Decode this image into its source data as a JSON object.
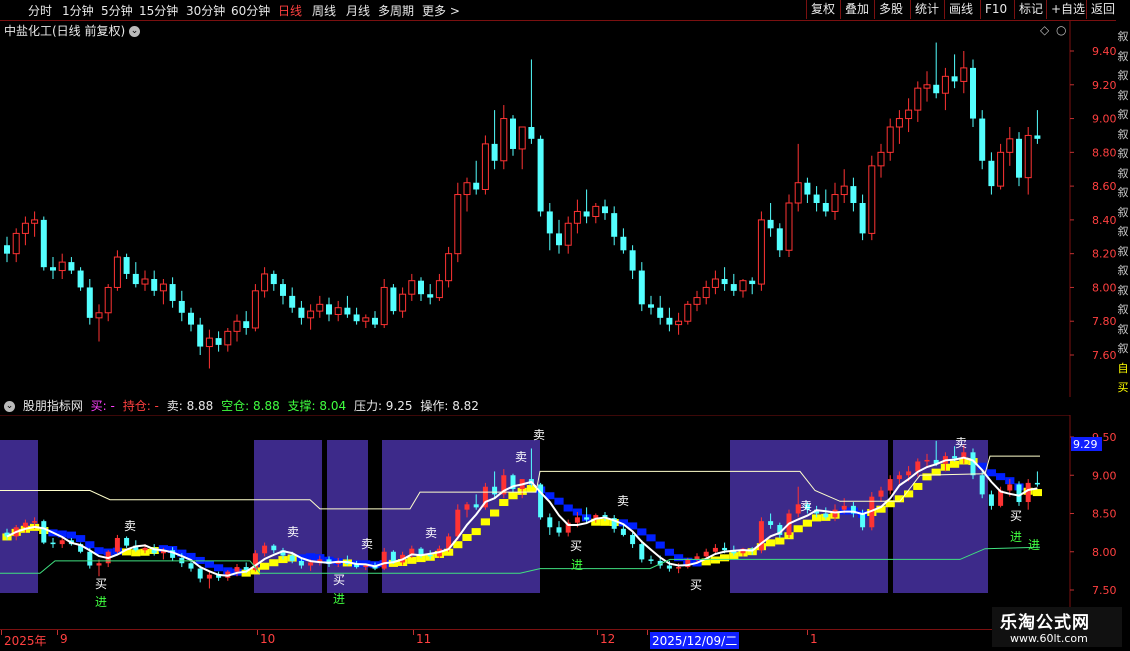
{
  "toolbar": {
    "periods": [
      "分时",
      "1分钟",
      "5分钟",
      "15分钟",
      "30分钟",
      "60分钟",
      "日线",
      "周线",
      "月线",
      "多周期",
      "更多 >"
    ],
    "active": "日线",
    "right_buttons": [
      "复权",
      "叠加",
      "多股",
      "统计",
      "画线",
      "F10",
      "标记",
      "+自选",
      "返回"
    ]
  },
  "stock": {
    "title": "中盐化工(日线 前复权)"
  },
  "main_axis": {
    "labels": [
      "9.40",
      "9.20",
      "9.00",
      "8.80",
      "8.60",
      "8.40",
      "8.20",
      "8.00",
      "7.80",
      "7.60"
    ]
  },
  "indicator": {
    "name": "股朋指标网",
    "buy": "买: -",
    "hold": "持仓: -",
    "sell": "卖: 8.88",
    "empty": "空仓: 8.88",
    "support": "支撑: 8.04",
    "pressure": "压力: 9.25",
    "operation": "操作: 8.82",
    "current_value": "9.29"
  },
  "sub_axis": {
    "labels": [
      "9.50",
      "9.00",
      "8.50",
      "8.00",
      "7.50"
    ]
  },
  "x_axis": {
    "labels": [
      "2025年",
      "9",
      "10",
      "11",
      "12",
      "2025/12/09/二",
      "1"
    ]
  },
  "right_column": {
    "chars": [
      "叙",
      "叙",
      "叙",
      "叙",
      "叙",
      "叙",
      "叙",
      "叙",
      "叙",
      "叙",
      "叙",
      "叙",
      "叙",
      "叙",
      "叙",
      "叙",
      "叙",
      "自",
      "买"
    ]
  },
  "signals": {
    "sell": "卖",
    "buy": "买",
    "enter": "进"
  },
  "watermark": {
    "name": "乐淘公式网",
    "url": "www.60lt.com"
  },
  "colors": {
    "up": "#ff3333",
    "down": "#54ffff",
    "band": "#3d2a8a",
    "yellow": "#ffff00",
    "blue": "#0020ff",
    "axis": "#7a1010"
  },
  "chart_data": {
    "type": "candlestick",
    "ylim": [
      7.5,
      9.5
    ],
    "candles": [
      [
        8.25,
        8.3,
        8.15,
        8.2
      ],
      [
        8.2,
        8.35,
        8.15,
        8.32
      ],
      [
        8.32,
        8.42,
        8.25,
        8.38
      ],
      [
        8.38,
        8.45,
        8.3,
        8.4
      ],
      [
        8.4,
        8.42,
        8.1,
        8.12
      ],
      [
        8.12,
        8.18,
        8.05,
        8.1
      ],
      [
        8.1,
        8.2,
        8.05,
        8.15
      ],
      [
        8.15,
        8.18,
        8.08,
        8.1
      ],
      [
        8.1,
        8.12,
        7.98,
        8.0
      ],
      [
        8.0,
        8.05,
        7.78,
        7.82
      ],
      [
        7.82,
        7.9,
        7.68,
        7.85
      ],
      [
        7.85,
        8.02,
        7.8,
        8.0
      ],
      [
        8.0,
        8.22,
        7.98,
        8.18
      ],
      [
        8.18,
        8.2,
        8.05,
        8.08
      ],
      [
        8.08,
        8.15,
        8.0,
        8.02
      ],
      [
        8.02,
        8.1,
        7.98,
        8.05
      ],
      [
        8.05,
        8.1,
        7.95,
        7.98
      ],
      [
        7.98,
        8.05,
        7.9,
        8.02
      ],
      [
        8.02,
        8.06,
        7.88,
        7.92
      ],
      [
        7.92,
        7.98,
        7.8,
        7.85
      ],
      [
        7.85,
        7.88,
        7.74,
        7.78
      ],
      [
        7.78,
        7.82,
        7.6,
        7.65
      ],
      [
        7.65,
        7.75,
        7.52,
        7.7
      ],
      [
        7.7,
        7.74,
        7.62,
        7.66
      ],
      [
        7.66,
        7.76,
        7.62,
        7.74
      ],
      [
        7.74,
        7.84,
        7.68,
        7.8
      ],
      [
        7.8,
        7.86,
        7.72,
        7.76
      ],
      [
        7.76,
        8.02,
        7.74,
        7.98
      ],
      [
        7.98,
        8.12,
        7.94,
        8.08
      ],
      [
        8.08,
        8.1,
        7.98,
        8.02
      ],
      [
        8.02,
        8.05,
        7.9,
        7.95
      ],
      [
        7.95,
        8.0,
        7.85,
        7.88
      ],
      [
        7.88,
        7.92,
        7.78,
        7.82
      ],
      [
        7.82,
        7.9,
        7.75,
        7.86
      ],
      [
        7.86,
        7.95,
        7.82,
        7.9
      ],
      [
        7.9,
        7.94,
        7.8,
        7.84
      ],
      [
        7.84,
        7.92,
        7.8,
        7.88
      ],
      [
        7.88,
        7.95,
        7.82,
        7.84
      ],
      [
        7.84,
        7.88,
        7.78,
        7.8
      ],
      [
        7.8,
        7.84,
        7.76,
        7.82
      ],
      [
        7.82,
        7.86,
        7.76,
        7.78
      ],
      [
        7.78,
        8.05,
        7.76,
        8.0
      ],
      [
        8.0,
        8.02,
        7.84,
        7.86
      ],
      [
        7.86,
        8.0,
        7.82,
        7.96
      ],
      [
        7.96,
        8.08,
        7.92,
        8.04
      ],
      [
        8.04,
        8.06,
        7.92,
        7.96
      ],
      [
        7.96,
        8.02,
        7.9,
        7.94
      ],
      [
        7.94,
        8.08,
        7.92,
        8.04
      ],
      [
        8.04,
        8.24,
        8.0,
        8.2
      ],
      [
        8.2,
        8.62,
        8.15,
        8.55
      ],
      [
        8.55,
        8.65,
        8.45,
        8.62
      ],
      [
        8.62,
        8.75,
        8.55,
        8.58
      ],
      [
        8.58,
        8.9,
        8.55,
        8.85
      ],
      [
        8.85,
        9.05,
        8.7,
        8.75
      ],
      [
        8.75,
        9.08,
        8.7,
        9.0
      ],
      [
        9.0,
        9.02,
        8.78,
        8.82
      ],
      [
        8.82,
        8.85,
        8.7,
        8.95
      ],
      [
        8.95,
        9.35,
        8.85,
        8.88
      ],
      [
        8.88,
        8.9,
        8.42,
        8.45
      ],
      [
        8.45,
        8.5,
        8.22,
        8.32
      ],
      [
        8.32,
        8.4,
        8.2,
        8.25
      ],
      [
        8.25,
        8.42,
        8.2,
        8.38
      ],
      [
        8.38,
        8.52,
        8.32,
        8.45
      ],
      [
        8.45,
        8.58,
        8.38,
        8.42
      ],
      [
        8.42,
        8.5,
        8.38,
        8.48
      ],
      [
        8.48,
        8.52,
        8.4,
        8.44
      ],
      [
        8.44,
        8.48,
        8.25,
        8.3
      ],
      [
        8.3,
        8.35,
        8.2,
        8.22
      ],
      [
        8.22,
        8.25,
        8.05,
        8.1
      ],
      [
        8.1,
        8.15,
        7.86,
        7.9
      ],
      [
        7.9,
        7.95,
        7.84,
        7.88
      ],
      [
        7.88,
        7.95,
        7.78,
        7.82
      ],
      [
        7.82,
        7.88,
        7.74,
        7.78
      ],
      [
        7.78,
        7.85,
        7.72,
        7.8
      ],
      [
        7.8,
        7.92,
        7.78,
        7.9
      ],
      [
        7.9,
        7.98,
        7.86,
        7.94
      ],
      [
        7.94,
        8.04,
        7.9,
        8.0
      ],
      [
        8.0,
        8.1,
        7.96,
        8.05
      ],
      [
        8.05,
        8.12,
        7.98,
        8.02
      ],
      [
        8.02,
        8.08,
        7.95,
        7.98
      ],
      [
        7.98,
        8.05,
        7.94,
        8.04
      ],
      [
        8.04,
        8.06,
        7.96,
        8.02
      ],
      [
        8.02,
        8.45,
        7.98,
        8.4
      ],
      [
        8.4,
        8.5,
        8.3,
        8.35
      ],
      [
        8.35,
        8.38,
        8.18,
        8.22
      ],
      [
        8.22,
        8.55,
        8.18,
        8.5
      ],
      [
        8.5,
        8.85,
        8.45,
        8.62
      ],
      [
        8.62,
        8.65,
        8.5,
        8.55
      ],
      [
        8.55,
        8.6,
        8.45,
        8.5
      ],
      [
        8.5,
        8.58,
        8.42,
        8.45
      ],
      [
        8.45,
        8.62,
        8.4,
        8.55
      ],
      [
        8.55,
        8.7,
        8.5,
        8.6
      ],
      [
        8.6,
        8.65,
        8.45,
        8.5
      ],
      [
        8.5,
        8.55,
        8.28,
        8.32
      ],
      [
        8.32,
        8.78,
        8.28,
        8.72
      ],
      [
        8.72,
        8.85,
        8.65,
        8.8
      ],
      [
        8.8,
        9.0,
        8.75,
        8.95
      ],
      [
        8.95,
        9.05,
        8.85,
        9.0
      ],
      [
        9.0,
        9.12,
        8.92,
        9.05
      ],
      [
        9.05,
        9.22,
        8.98,
        9.18
      ],
      [
        9.18,
        9.28,
        9.1,
        9.2
      ],
      [
        9.2,
        9.45,
        9.12,
        9.15
      ],
      [
        9.15,
        9.3,
        9.05,
        9.25
      ],
      [
        9.25,
        9.38,
        9.18,
        9.22
      ],
      [
        9.22,
        9.4,
        9.15,
        9.3
      ],
      [
        9.3,
        9.35,
        8.95,
        9.0
      ],
      [
        9.0,
        9.05,
        8.7,
        8.75
      ],
      [
        8.75,
        8.8,
        8.55,
        8.6
      ],
      [
        8.6,
        8.85,
        8.58,
        8.8
      ],
      [
        8.8,
        8.95,
        8.72,
        8.88
      ],
      [
        8.88,
        8.92,
        8.6,
        8.65
      ],
      [
        8.65,
        8.95,
        8.55,
        8.9
      ],
      [
        8.9,
        9.05,
        8.85,
        8.88
      ]
    ]
  }
}
